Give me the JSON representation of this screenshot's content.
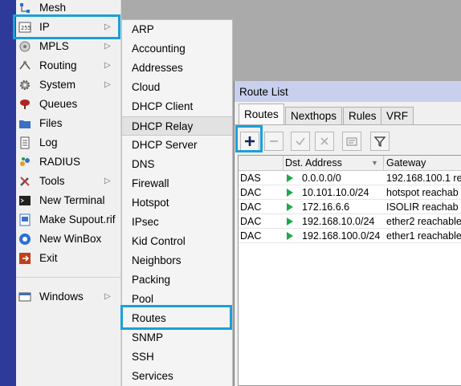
{
  "main_menu": {
    "items": [
      {
        "label": "Mesh",
        "icon": "mesh-icon",
        "submenu": false
      },
      {
        "label": "IP",
        "icon": "ip-icon",
        "submenu": true
      },
      {
        "label": "MPLS",
        "icon": "mpls-icon",
        "submenu": true
      },
      {
        "label": "Routing",
        "icon": "routing-icon",
        "submenu": true
      },
      {
        "label": "System",
        "icon": "gear-icon",
        "submenu": true
      },
      {
        "label": "Queues",
        "icon": "queues-icon",
        "submenu": false
      },
      {
        "label": "Files",
        "icon": "folder-icon",
        "submenu": false
      },
      {
        "label": "Log",
        "icon": "log-icon",
        "submenu": false
      },
      {
        "label": "RADIUS",
        "icon": "radius-icon",
        "submenu": false
      },
      {
        "label": "Tools",
        "icon": "tools-icon",
        "submenu": true
      },
      {
        "label": "New Terminal",
        "icon": "terminal-icon",
        "submenu": false
      },
      {
        "label": "Make Supout.rif",
        "icon": "supout-icon",
        "submenu": false
      },
      {
        "label": "New WinBox",
        "icon": "winbox-icon",
        "submenu": false
      },
      {
        "label": "Exit",
        "icon": "exit-icon",
        "submenu": false
      },
      {
        "label": "Windows",
        "icon": "windows-icon",
        "submenu": true
      }
    ]
  },
  "ip_submenu": {
    "items": [
      "ARP",
      "Accounting",
      "Addresses",
      "Cloud",
      "DHCP Client",
      "DHCP Relay",
      "DHCP Server",
      "DNS",
      "Firewall",
      "Hotspot",
      "IPsec",
      "Kid Control",
      "Neighbors",
      "Packing",
      "Pool",
      "Routes",
      "SNMP",
      "SSH",
      "Services"
    ]
  },
  "route_list": {
    "title": "Route List",
    "tabs": [
      "Routes",
      "Nexthops",
      "Rules",
      "VRF"
    ],
    "columns": {
      "dst": "Dst. Address",
      "gateway": "Gateway"
    },
    "rows": [
      {
        "flags": "DAS",
        "dst": "0.0.0.0/0",
        "gateway": "192.168.100.1 re"
      },
      {
        "flags": "DAC",
        "dst": "10.101.10.0/24",
        "gateway": "hotspot reachab"
      },
      {
        "flags": "DAC",
        "dst": "172.16.6.6",
        "gateway": "ISOLIR reachab"
      },
      {
        "flags": "DAC",
        "dst": "192.168.10.0/24",
        "gateway": "ether2 reachable"
      },
      {
        "flags": "DAC",
        "dst": "192.168.100.0/24",
        "gateway": "ether1 reachable"
      }
    ]
  },
  "colors": {
    "highlight": "#1aa0d8",
    "active_route": "#1fa84a",
    "sidebar_edge": "#2e3a9a"
  }
}
